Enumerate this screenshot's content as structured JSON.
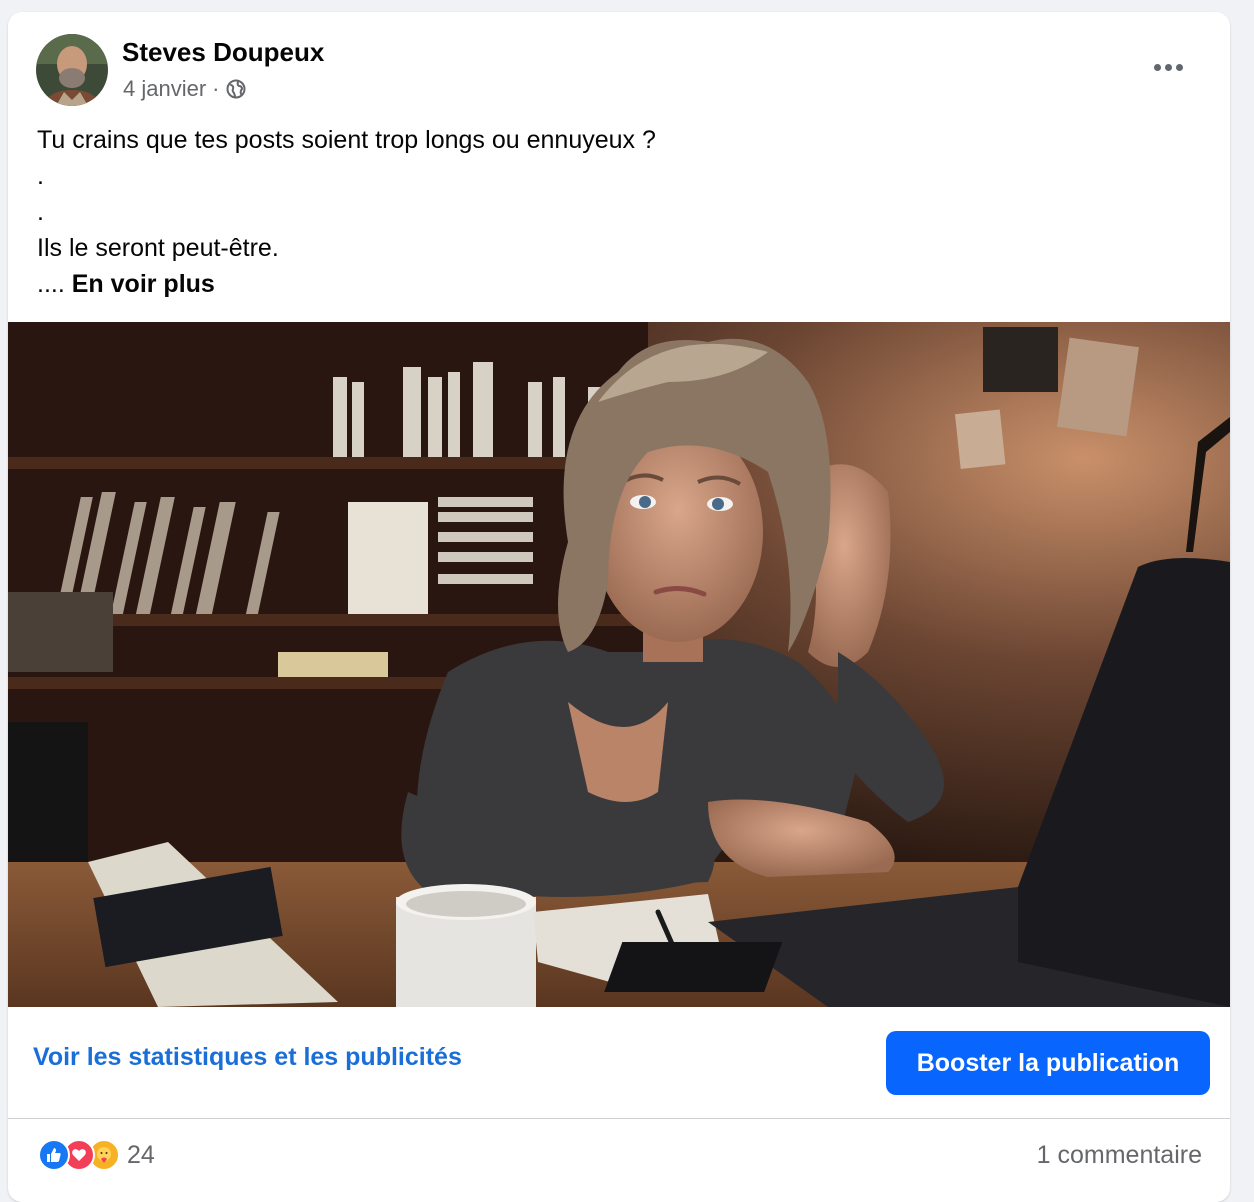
{
  "post": {
    "author": "Steves Doupeux",
    "date": "4 janvier",
    "separator": "·",
    "audience_icon": "globe-icon",
    "text_lines": [
      "Tu crains que tes posts soient trop longs ou ennuyeux ?",
      ".",
      ".",
      "Ils le seront peut-être."
    ],
    "ellipsis": "....",
    "see_more": "En voir plus"
  },
  "actions": {
    "stats_link": "Voir les statistiques et les publicités",
    "boost_button": "Booster la publication"
  },
  "footer": {
    "reaction_icons": [
      "like-icon",
      "love-icon",
      "care-icon"
    ],
    "reaction_count": "24",
    "comments": "1 commentaire"
  },
  "colors": {
    "link": "#1a6ed8",
    "boost": "#0866ff",
    "secondary_text": "#65676b"
  }
}
